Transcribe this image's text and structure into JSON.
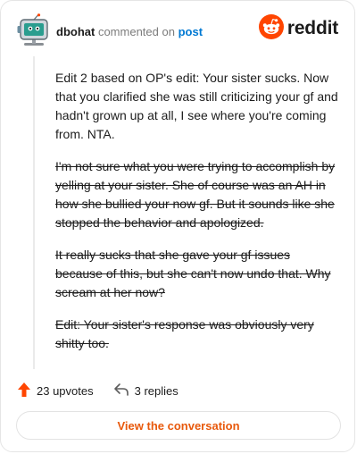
{
  "header": {
    "username": "dbohat",
    "action_text": "commented on",
    "target_link": "post",
    "brand": "reddit"
  },
  "comment": {
    "paragraphs": [
      {
        "text": "Edit 2 based on OP's edit: Your sister sucks. Now that you clarified she was still criticizing your gf and hadn't grown up at all, I see where you're coming from. NTA.",
        "struck": false
      },
      {
        "text": "I'm not sure what you were trying to accomplish by yelling at your sister. She of course was an AH in how she bullied your now gf. But it sounds like she stopped the behavior and apologized.",
        "struck": true
      },
      {
        "text": "It really sucks that she gave your gf issues because of this, but she can't now undo that. Why scream at her now?",
        "struck": true
      },
      {
        "text": "Edit: Your sister's response was obviously very shitty too.",
        "struck": true
      }
    ]
  },
  "footer": {
    "upvotes_label": "23 upvotes",
    "replies_label": "3 replies"
  },
  "cta": {
    "label": "View the conversation"
  },
  "colors": {
    "brand": "#ff4500",
    "link": "#0079d3",
    "cta_text": "#e8590c",
    "upvote": "#ff4500"
  },
  "icons": {
    "avatar": "snoo-avatar-icon",
    "brand": "reddit-logo-icon",
    "upvote": "upvote-arrow-icon",
    "reply": "reply-arrow-icon"
  }
}
